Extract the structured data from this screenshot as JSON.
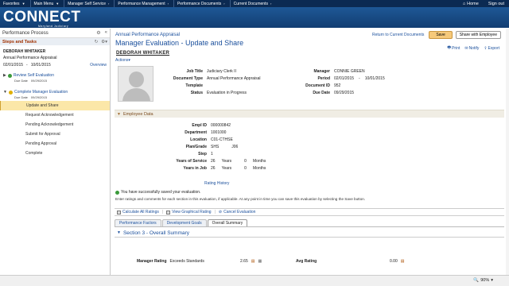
{
  "topmenu": {
    "items": [
      "Favorites",
      "Main Menu",
      "Manager Self Service",
      "Performance Management",
      "Performance Documents",
      "Current Documents"
    ],
    "home": "Home",
    "signout": "Sign out"
  },
  "banner": {
    "logo": "CONNECT",
    "sub": "Maryland Judiciary"
  },
  "left": {
    "title": "Performance Process",
    "steps_title": "Steps and Tasks",
    "employee": "DEBORAH WHITAKER",
    "doc_title": "Annual Performance Appraisal",
    "date_from": "02/01/2015",
    "date_sep": "-",
    "date_to": "10/01/2015",
    "overview": "Overview",
    "task1": {
      "label": "Review Self Evaluation",
      "due_label": "Due Date",
      "due": "09/29/2015"
    },
    "task2": {
      "label": "Complete Manager Evaluation",
      "due_label": "Due Date",
      "due": "09/29/2015"
    },
    "subs": [
      "Update and Share",
      "Request Acknowledgement",
      "Pending Acknowledgement",
      "Submit for Approval",
      "Pending Approval",
      "Complete"
    ]
  },
  "header": {
    "breadcrumb": "Annual Performance Appraisal",
    "title": "Manager Evaluation - Update and Share",
    "employee": "DEBORAH WHITAKER",
    "actions": "Actions",
    "return_link": "Return to Current Documents",
    "save": "Save",
    "share": "Share with Employee",
    "print": "Print",
    "notify": "Notify",
    "export": "Export"
  },
  "doc": {
    "job_title_label": "Job Title",
    "job_title": "Judiciary Clerk II",
    "doc_type_label": "Document Type",
    "doc_type": "Annual Performance Appraisal",
    "template_label": "Template",
    "template": "",
    "status_label": "Status",
    "status": "Evaluation in Progress",
    "manager_label": "Manager",
    "manager": "CONNIE GREEN",
    "period_label": "Period",
    "period_from": "02/01/2015",
    "period_sep": "-",
    "period_to": "10/01/2015",
    "doc_id_label": "Document ID",
    "doc_id": "952",
    "due_label": "Due Date",
    "due": "09/29/2015"
  },
  "employee_data": {
    "section_title": "Employee Data",
    "empl_id_label": "Empl ID",
    "empl_id": "000000842",
    "department_label": "Department",
    "department": "1001000",
    "location_label": "Location",
    "location": "C01-CTHSE",
    "plan_grade_label": "Plan/Grade",
    "plan": "SHS",
    "grade": "J06",
    "step_label": "Step",
    "step": "1",
    "yos_label": "Years of Service",
    "yos_years": "26",
    "yos_years_unit": "Years",
    "yos_months": "0",
    "yos_months_unit": "Months",
    "yij_label": "Years in Job",
    "yij_years": "26",
    "yij_years_unit": "Years",
    "yij_months": "0",
    "yij_months_unit": "Months"
  },
  "rating_history": "Rating History",
  "saved_msg": "You have successfully saved your evaluation.",
  "instructions": "Enter ratings and comments for each section in this evaluation, if applicable. At any point in time you can save this evaluation by selecting the Save button.",
  "actionbar": {
    "calc": "Calculate All Ratings",
    "graph": "View Graphical Rating",
    "cancel": "Cancel Evaluation"
  },
  "tabs": [
    "Performance Factors",
    "Development Goals",
    "Overall Summary"
  ],
  "section3": {
    "title": "Section 3 - Overall Summary",
    "mgr_rating_label": "Manager Rating",
    "mgr_rating": "Exceeds Standards",
    "mgr_rating_value": "2.65",
    "avg_rating_label": "Avg Rating",
    "avg_rating_value": "0.00"
  },
  "status": {
    "zoom": "90%"
  },
  "colors": {
    "topbar": "#0b2a52",
    "banner": "#1e5896",
    "link": "#1a4f9c",
    "accent": "#a03000"
  }
}
